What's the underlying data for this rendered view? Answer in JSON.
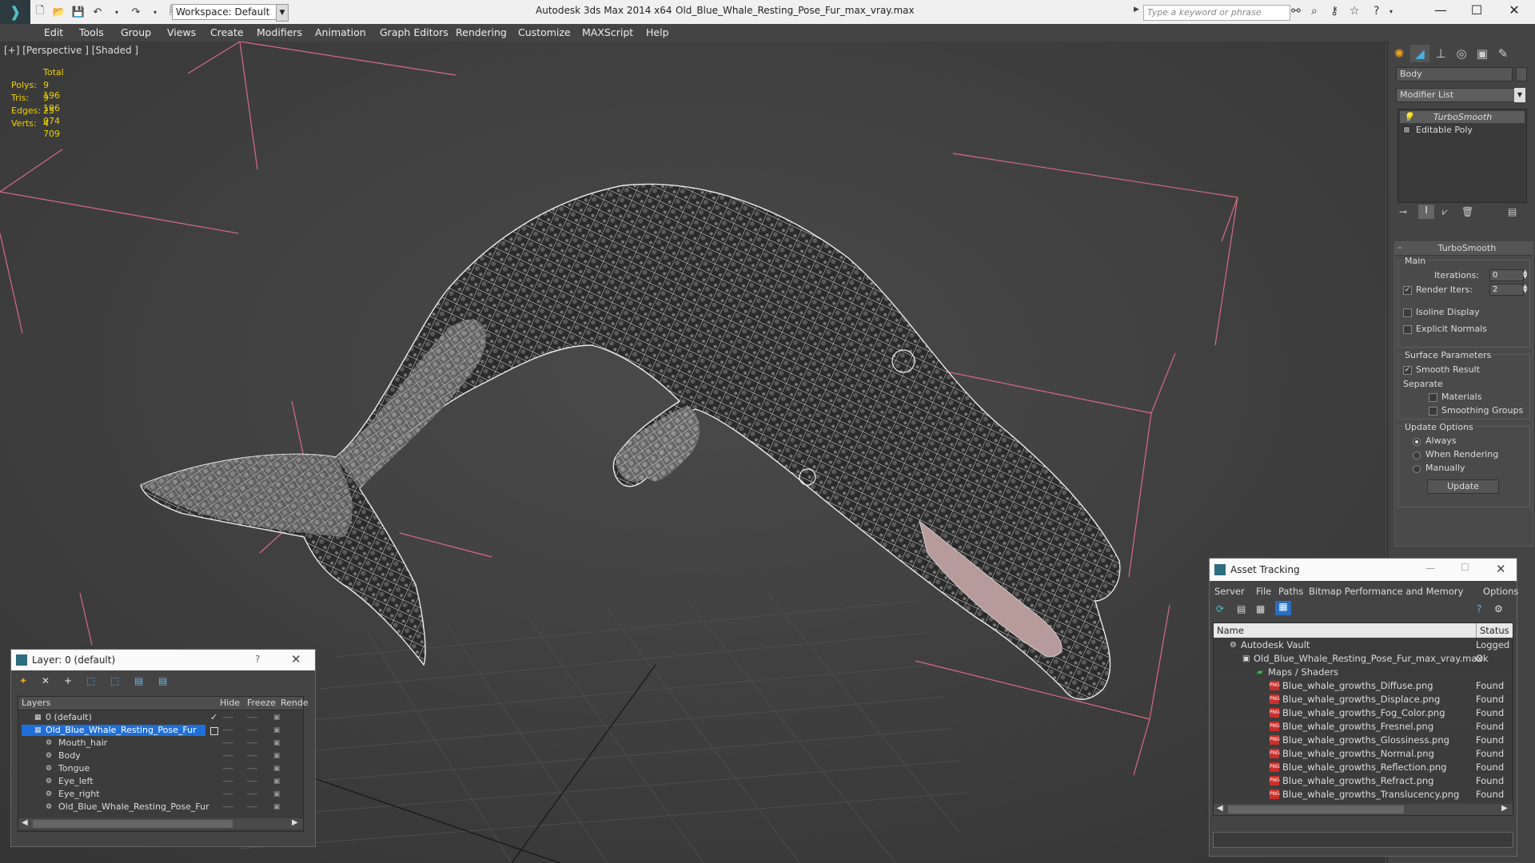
{
  "titlebar": {
    "workspace": "Workspace: Default",
    "app_title": "Autodesk 3ds Max  2014 x64",
    "doc_title": "Old_Blue_Whale_Resting_Pose_Fur_max_vray.max",
    "search_placeholder": "Type a keyword or phrase"
  },
  "menu": [
    "Edit",
    "Tools",
    "Group",
    "Views",
    "Create",
    "Modifiers",
    "Animation",
    "Graph Editors",
    "Rendering",
    "Customize",
    "MAXScript",
    "Help"
  ],
  "viewport": {
    "label": "[+] [Perspective ] [Shaded ]",
    "stats": {
      "header": "Total",
      "rows": [
        {
          "k": "Polys:",
          "v": "9 196"
        },
        {
          "k": "Tris:",
          "v": "9 196"
        },
        {
          "k": "Edges:",
          "v": "25 074"
        },
        {
          "k": "Verts:",
          "v": "4 709"
        }
      ]
    }
  },
  "cmdpanel": {
    "object_name": "Body",
    "modifier_list": "Modifier List",
    "stack": [
      "TurboSmooth",
      "Editable Poly"
    ],
    "rollout_title": "TurboSmooth",
    "main_label": "Main",
    "iterations_label": "Iterations:",
    "iterations_value": "0",
    "render_iters_label": "Render Iters:",
    "render_iters_value": "2",
    "isoline": "Isoline Display",
    "explicit": "Explicit Normals",
    "surface_params": "Surface Parameters",
    "smooth_result": "Smooth Result",
    "separate": "Separate",
    "materials": "Materials",
    "smoothing_groups": "Smoothing Groups",
    "update_options": "Update Options",
    "always": "Always",
    "when_rendering": "When Rendering",
    "manually": "Manually",
    "update_btn": "Update"
  },
  "layer_dialog": {
    "title": "Layer: 0 (default)",
    "help": "?",
    "headers": {
      "layers": "Layers",
      "hide": "Hide",
      "freeze": "Freeze",
      "render": "Rende"
    },
    "rows": [
      "0 (default)",
      "Old_Blue_Whale_Resting_Pose_Fur",
      "Mouth_hair",
      "Body",
      "Tongue",
      "Eye_left",
      "Eye_right",
      "Old_Blue_Whale_Resting_Pose_Fur"
    ]
  },
  "asset_dialog": {
    "title": "Asset Tracking",
    "menu": [
      "Server",
      "File",
      "Paths",
      "Bitmap Performance and Memory",
      "Options"
    ],
    "headers": {
      "name": "Name",
      "status": "Status"
    },
    "vault": {
      "name": "Autodesk Vault",
      "status": "Logged O"
    },
    "file": {
      "name": "Old_Blue_Whale_Resting_Pose_Fur_max_vray.max",
      "status": "Ok"
    },
    "maps": "Maps / Shaders",
    "files": [
      {
        "name": "Blue_whale_growths_Diffuse.png",
        "status": "Found"
      },
      {
        "name": "Blue_whale_growths_Displace.png",
        "status": "Found"
      },
      {
        "name": "Blue_whale_growths_Fog_Color.png",
        "status": "Found"
      },
      {
        "name": "Blue_whale_growths_Fresnel.png",
        "status": "Found"
      },
      {
        "name": "Blue_whale_growths_Glossiness.png",
        "status": "Found"
      },
      {
        "name": "Blue_whale_growths_Normal.png",
        "status": "Found"
      },
      {
        "name": "Blue_whale_growths_Reflection.png",
        "status": "Found"
      },
      {
        "name": "Blue_whale_growths_Refract.png",
        "status": "Found"
      },
      {
        "name": "Blue_whale_growths_Translucency.png",
        "status": "Found"
      }
    ]
  }
}
